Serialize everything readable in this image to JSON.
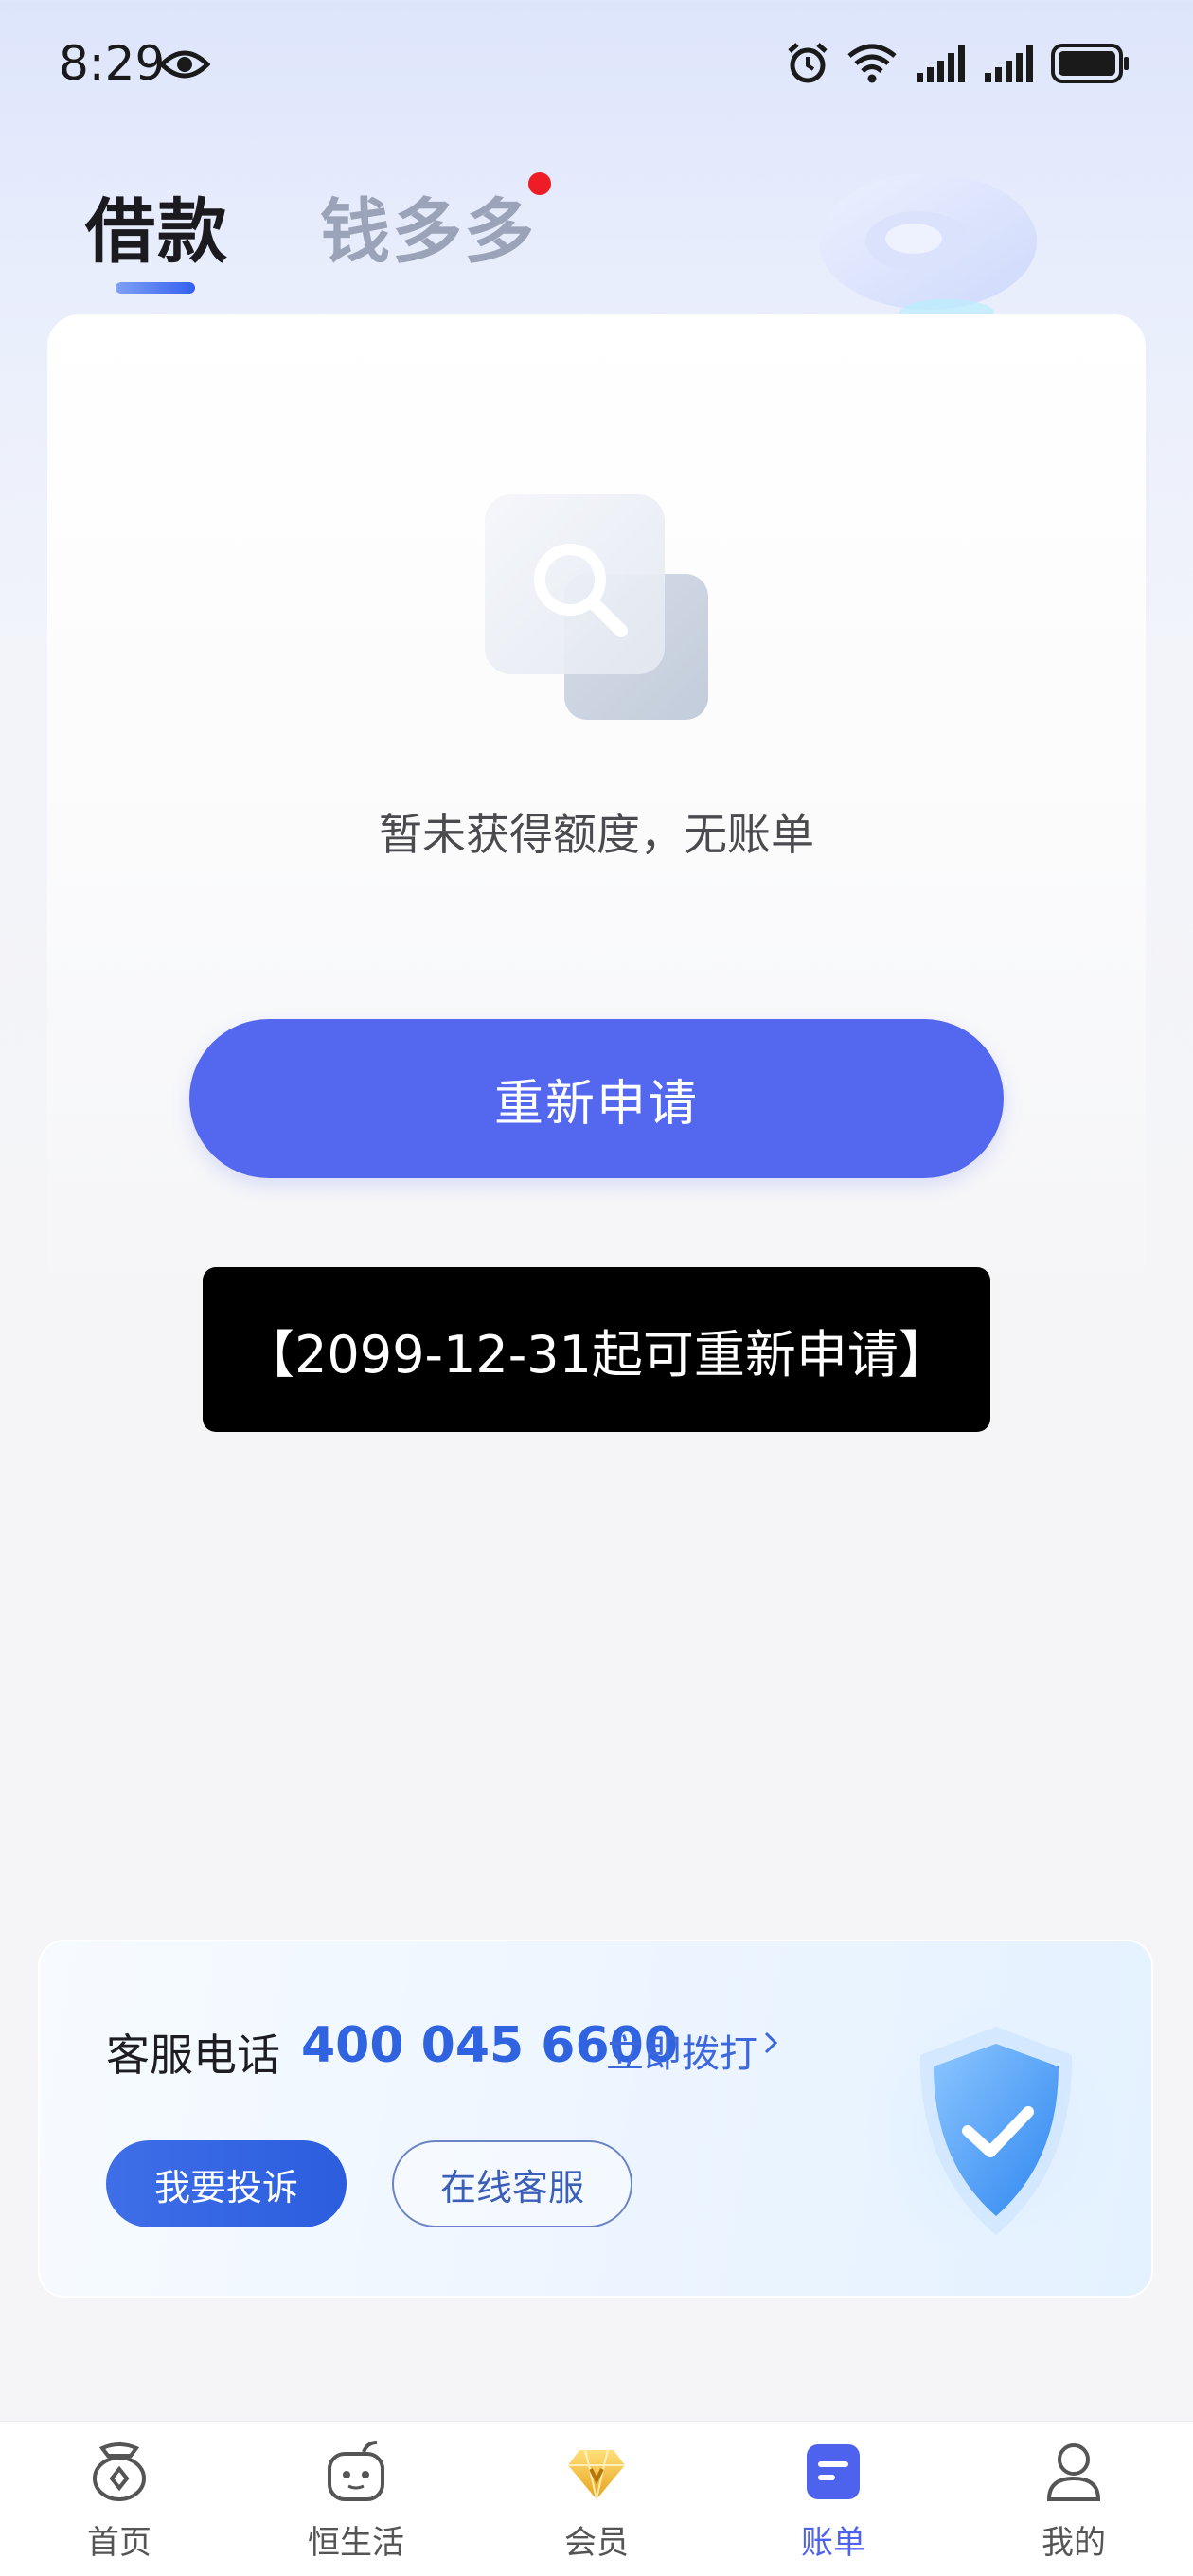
{
  "status_bar": {
    "time": "8:29",
    "icons": [
      "eye-icon",
      "alarm-icon",
      "wifi-icon",
      "signal-icon",
      "signal-icon",
      "battery-icon"
    ]
  },
  "tabs": [
    {
      "label": "借款",
      "active": true
    },
    {
      "label": "钱多多",
      "active": false,
      "has_red_dot": true
    }
  ],
  "empty_state": {
    "icon": "search-empty-icon",
    "message": "暂未获得额度，无账单"
  },
  "primary_button": {
    "label": "重新申请",
    "color": "#5468ef"
  },
  "toast": {
    "text": "【2099-12-31起可重新申请】"
  },
  "service": {
    "label": "客服电话",
    "phone": "400 045 6600",
    "call_label": "立即拨打",
    "complaint_button": "我要投诉",
    "online_button": "在线客服",
    "badge_icon": "shield-check-icon"
  },
  "bottom_nav": {
    "items": [
      {
        "label": "首页",
        "icon": "home-bag-icon",
        "active": false
      },
      {
        "label": "恒生活",
        "icon": "life-face-icon",
        "active": false
      },
      {
        "label": "会员",
        "icon": "diamond-icon",
        "active": false
      },
      {
        "label": "账单",
        "icon": "bill-icon",
        "active": true
      },
      {
        "label": "我的",
        "icon": "profile-icon",
        "active": false
      }
    ]
  },
  "colors": {
    "accent": "#5468ef",
    "phone_blue": "#2f63e0",
    "red_dot": "#ee1c25"
  }
}
